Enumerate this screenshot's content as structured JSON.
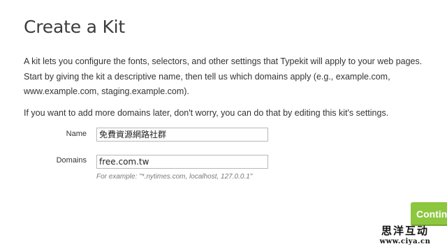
{
  "page": {
    "title": "Create a Kit",
    "intro": "A kit lets you configure the fonts, selectors, and other settings that Typekit will apply to your web pages. Start by giving the kit a descriptive name, then tell us which domains apply (e.g., example.com, www.example.com, staging.example.com).",
    "intro_more": "If you want to add more domains later, don't worry, you can do that by editing this kit's settings."
  },
  "form": {
    "name_label": "Name",
    "name_value": "免費資源網路社群",
    "domains_label": "Domains",
    "domains_value": "free.com.tw",
    "domains_hint": "For example: \"*.nytimes.com, localhost, 127.0.0.1\""
  },
  "actions": {
    "continue_label": "Continue"
  },
  "watermark": {
    "top": "思洋互动",
    "bottom": "www.ciya.cn"
  },
  "colors": {
    "accent": "#8dc63f",
    "text": "#333333",
    "hint": "#7a7a7a"
  }
}
